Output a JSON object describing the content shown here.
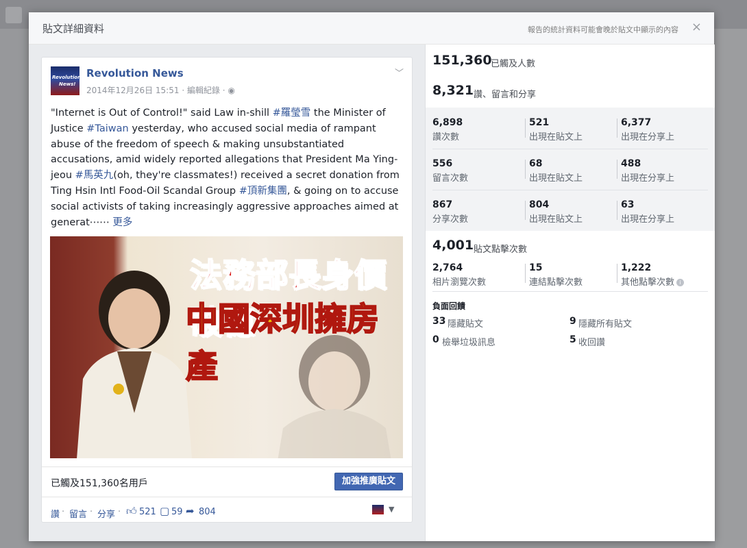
{
  "modal": {
    "title": "貼文詳細資料",
    "note": "報告的統計資料可能會晚於貼文中顯示的內容",
    "close": "×"
  },
  "post": {
    "author": "Revolution News",
    "avatar_line1": "Revolution",
    "avatar_line2": "News!",
    "date": "2014年12月26日 15:51",
    "edit_history": "編輯紀錄",
    "text_1": "\"Internet is Out of Control!\" said Law in-shill ",
    "tag_1": "#羅瑩雪",
    "text_2": " the Minister of Justice ",
    "tag_2": "#Taiwan",
    "text_3": " yesterday, who accused social media of rampant abuse of the freedom of speech & making unsubstantiated accusations, amid widely reported allegations that President Ma Ying-jeou ",
    "tag_3": "#馬英九",
    "text_4": "(oh, they're classmates!) received a secret donation from Ting Hsin Intl Food-Oil Scandal Group ",
    "tag_4": "#頂新集團",
    "text_5": ", & going on to accuse social activists of taking increasingly aggressive approaches aimed at generat⋯⋯ ",
    "more": "更多",
    "image_headline_1": "法務部長身價破億",
    "image_headline_2": "中國深圳擁房產",
    "reach_text": "已觸及151,360名用戶",
    "boost_label": "加強推廣貼文",
    "actions": {
      "like": "讚",
      "comment": "留言",
      "share": "分享"
    },
    "counts": {
      "likes": "521",
      "comments": "59",
      "shares": "804"
    }
  },
  "insights": {
    "reach": {
      "value": "151,360",
      "label": "已觸及人數"
    },
    "engagement": {
      "value": "8,321",
      "label": "讚、留言和分享"
    },
    "rows": [
      [
        {
          "value": "6,898",
          "label": "讚次數"
        },
        {
          "value": "521",
          "label": "出現在貼文上"
        },
        {
          "value": "6,377",
          "label": "出現在分享上"
        }
      ],
      [
        {
          "value": "556",
          "label": "留言次數"
        },
        {
          "value": "68",
          "label": "出現在貼文上"
        },
        {
          "value": "488",
          "label": "出現在分享上"
        }
      ],
      [
        {
          "value": "867",
          "label": "分享次數"
        },
        {
          "value": "804",
          "label": "出現在貼文上"
        },
        {
          "value": "63",
          "label": "出現在分享上"
        }
      ]
    ],
    "clicks": {
      "value": "4,001",
      "label": "貼文點擊次數"
    },
    "click_rows": [
      {
        "value": "2,764",
        "label": "相片瀏覽次數"
      },
      {
        "value": "15",
        "label": "連結點擊次數"
      },
      {
        "value": "1,222",
        "label": "其他點擊次數"
      }
    ],
    "negative_title": "負面回饋",
    "negative": [
      {
        "value": "33",
        "label": "隱藏貼文"
      },
      {
        "value": "9",
        "label": "隱藏所有貼文"
      },
      {
        "value": "0",
        "label": "檢舉垃圾訊息"
      },
      {
        "value": "5",
        "label": "收回讚"
      }
    ]
  }
}
